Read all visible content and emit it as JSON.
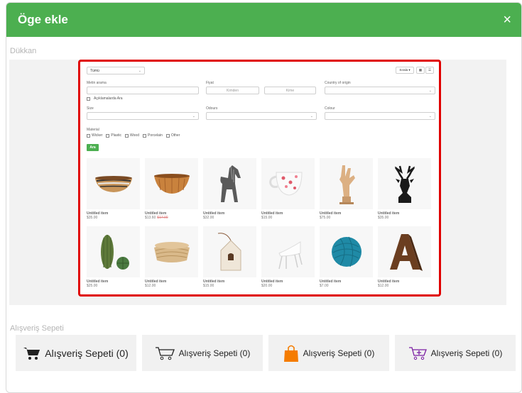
{
  "modal": {
    "title": "Öge ekle",
    "close_icon": "×"
  },
  "sections": {
    "shop": "Dükkan",
    "cart": "Alışveriş Sepeti"
  },
  "filters": {
    "category_selected": "Tümü",
    "sort_label": "Sırala ▾",
    "text_search_label": "Metin arama",
    "search_in_desc": "Açıklamalarda Ara",
    "price_label": "Fiyat",
    "price_from_placeholder": "Kimden",
    "price_to_placeholder": "Kime",
    "country_label": "Country of origin",
    "size_label": "Size",
    "odours_label": "Odours",
    "colour_label": "Colour",
    "material_label": "Material",
    "materials": [
      "Wicker",
      "Plastic",
      "Wood",
      "Porcelain",
      "Other"
    ],
    "search_button": "Ara"
  },
  "products": [
    {
      "name": "Untitled item",
      "price": "$35.00",
      "old_price": "",
      "icon": "bowl-stripes-icon"
    },
    {
      "name": "Untitled item",
      "price": "$13.60",
      "old_price": "$17.00",
      "icon": "wooden-bowl-icon"
    },
    {
      "name": "Untitled item",
      "price": "$32.00",
      "old_price": "",
      "icon": "horse-figurine-icon"
    },
    {
      "name": "Untitled item",
      "price": "$15.00",
      "old_price": "",
      "icon": "floral-mug-icon"
    },
    {
      "name": "Untitled item",
      "price": "$75.00",
      "old_price": "",
      "icon": "wooden-hand-icon"
    },
    {
      "name": "Untitled item",
      "price": "$35.00",
      "old_price": "",
      "icon": "deer-head-icon"
    },
    {
      "name": "Untitled item",
      "price": "$25.00",
      "old_price": "",
      "icon": "cactus-icon"
    },
    {
      "name": "Untitled item",
      "price": "$12.00",
      "old_price": "",
      "icon": "wicker-basket-icon"
    },
    {
      "name": "Untitled item",
      "price": "$15.00",
      "old_price": "",
      "icon": "birdhouse-icon"
    },
    {
      "name": "Untitled item",
      "price": "$20.00",
      "old_price": "",
      "icon": "white-chair-icon"
    },
    {
      "name": "Untitled item",
      "price": "$7.00",
      "old_price": "",
      "icon": "yarn-ball-icon"
    },
    {
      "name": "Untitled item",
      "price": "$12.00",
      "old_price": "",
      "icon": "letter-a-icon"
    }
  ],
  "cart_buttons": [
    {
      "label": "Alışveriş Sepeti (0)",
      "icon": "cart-filled-icon",
      "color": "#222222"
    },
    {
      "label": "Alışveriş Sepeti (0)",
      "icon": "cart-outline-icon",
      "color": "#222222"
    },
    {
      "label": "Alışveriş Sepeti (0)",
      "icon": "shopping-bag-icon",
      "color": "#f57c00"
    },
    {
      "label": "Alışveriş Sepeti (0)",
      "icon": "cart-plus-icon",
      "color": "#7b1fa2"
    }
  ],
  "colors": {
    "header": "#4caf50",
    "highlight": "#e00000",
    "button": "#4caf50"
  }
}
